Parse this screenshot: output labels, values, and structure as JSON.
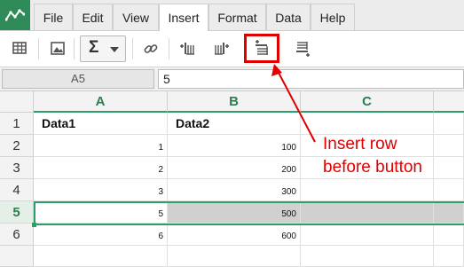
{
  "menu": {
    "tabs": [
      "File",
      "Edit",
      "View",
      "Insert",
      "Format",
      "Data",
      "Help"
    ],
    "active_tab": "Insert"
  },
  "toolbar": {
    "buttons": [
      {
        "name": "insert-table-icon"
      },
      {
        "name": "insert-image-icon"
      },
      {
        "name": "sigma-icon",
        "label": "Σ"
      },
      {
        "name": "insert-link-icon"
      },
      {
        "name": "insert-column-before-icon"
      },
      {
        "name": "insert-column-after-icon"
      },
      {
        "name": "insert-row-before-icon",
        "highlighted": true
      },
      {
        "name": "insert-row-after-icon"
      }
    ]
  },
  "formula_bar": {
    "cell_reference": "A5",
    "value": "5"
  },
  "sheet": {
    "columns": [
      "A",
      "B",
      "C"
    ],
    "rows": [
      {
        "header": "1",
        "cells": [
          "Data1",
          "Data2",
          ""
        ]
      },
      {
        "header": "2",
        "cells": [
          "1",
          "100",
          ""
        ]
      },
      {
        "header": "3",
        "cells": [
          "2",
          "200",
          ""
        ]
      },
      {
        "header": "4",
        "cells": [
          "3",
          "300",
          ""
        ]
      },
      {
        "header": "5",
        "cells": [
          "5",
          "500",
          ""
        ],
        "selected": true
      },
      {
        "header": "6",
        "cells": [
          "6",
          "600",
          ""
        ]
      }
    ]
  },
  "annotation": {
    "text_line1": "Insert row",
    "text_line2": "before button",
    "color": "#e00000"
  },
  "colors": {
    "accent_green": "#2e9e6a",
    "header_green": "#2e7d4f",
    "highlight_red": "#e00000"
  }
}
